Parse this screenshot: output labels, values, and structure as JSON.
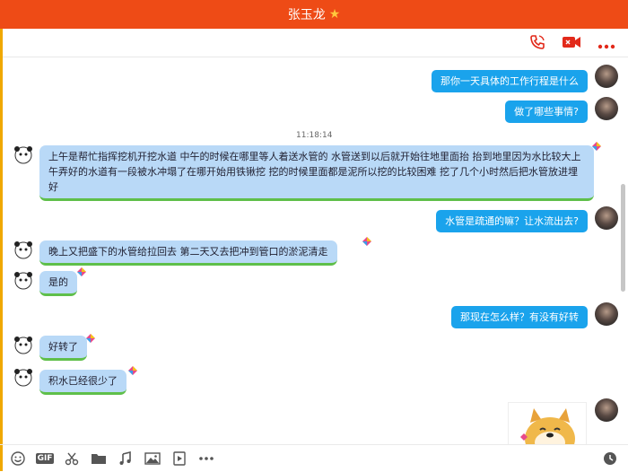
{
  "header": {
    "contact_name": "张玉龙"
  },
  "messages": [
    {
      "side": "right",
      "text": "那你一天具体的工作行程是什么"
    },
    {
      "side": "right",
      "text": "做了哪些事情?"
    },
    {
      "type": "time",
      "text": "11:18:14"
    },
    {
      "side": "left",
      "text": "上午是帮忙指挥挖机开挖水道 中午的时候在哪里等人着送水管的 水管送到以后就开始往地里面抬 抬到地里因为水比较大上午弄好的水道有一段被水冲塌了在哪开始用铁锹挖 挖的时候里面都是泥所以挖的比较困难 挖了几个小时然后把水管放进埋好"
    },
    {
      "side": "right",
      "text": "水管是疏通的嘛？让水流出去?"
    },
    {
      "side": "left",
      "text": "晚上又把盛下的水管给拉回去 第二天又去把冲到管口的淤泥清走"
    },
    {
      "side": "left",
      "text": "是的"
    },
    {
      "side": "right",
      "text": "那现在怎么样？有没有好转"
    },
    {
      "side": "left",
      "text": "好转了"
    },
    {
      "side": "left",
      "text": "积水已经很少了"
    }
  ],
  "toolbar_icons": [
    "emoji-icon",
    "gif-icon",
    "scissors-icon",
    "folder-icon",
    "music-icon",
    "image-icon",
    "video-icon",
    "more-icon",
    "history-icon"
  ],
  "toolbar_gif_label": "GIF",
  "colors": {
    "header": "#ee4b16",
    "right_bubble": "#1aa3ec",
    "left_bubble": "#b9d9f7",
    "action_red": "#e2291a"
  }
}
